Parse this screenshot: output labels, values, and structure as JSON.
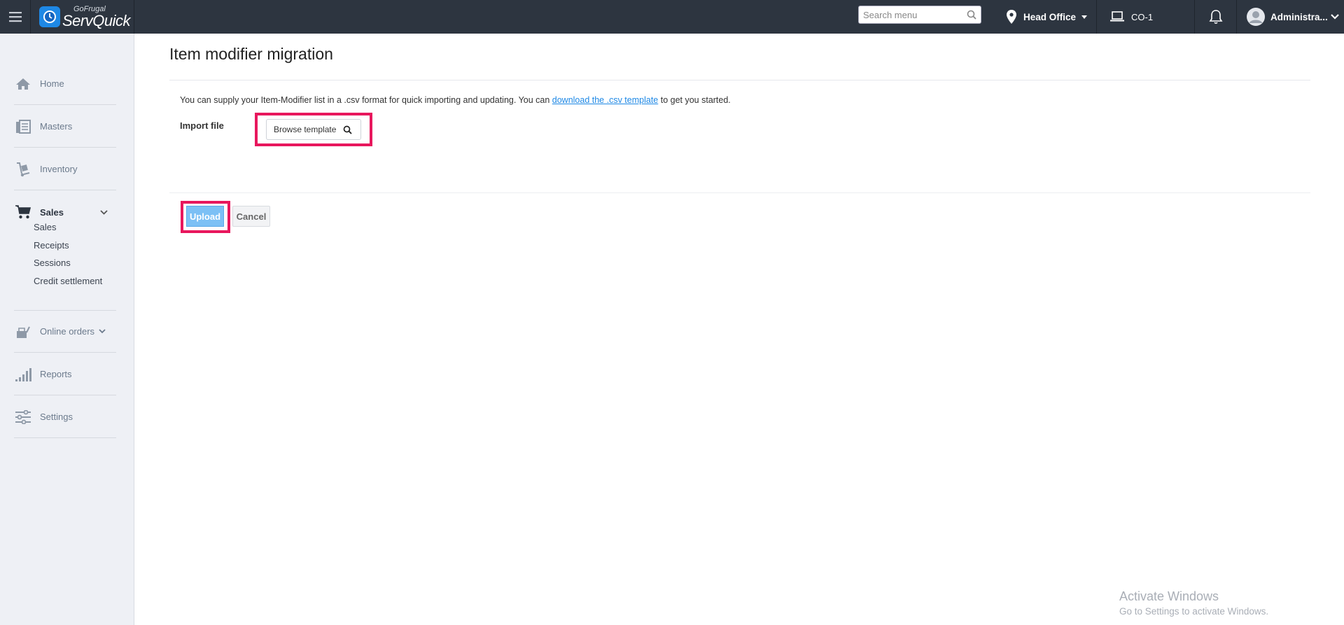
{
  "header": {
    "logo_small": "GoFrugal",
    "logo_big": "ServQuick",
    "search_placeholder": "Search menu",
    "location": "Head Office",
    "counter": "CO-1",
    "user": "Administra..."
  },
  "sidebar": {
    "items": [
      {
        "label": "Home"
      },
      {
        "label": "Masters"
      },
      {
        "label": "Inventory"
      },
      {
        "label": "Sales"
      },
      {
        "label": "Online orders"
      },
      {
        "label": "Reports"
      },
      {
        "label": "Settings"
      }
    ],
    "sales_sub": [
      {
        "label": "Sales"
      },
      {
        "label": "Receipts"
      },
      {
        "label": "Sessions"
      },
      {
        "label": "Credit settlement"
      }
    ]
  },
  "main": {
    "title": "Item modifier migration",
    "desc_before": "You can supply your Item-Modifier list in a .csv format for quick importing and updating. You can ",
    "desc_link": "download the .csv template",
    "desc_after": " to get you started.",
    "import_label": "Import file",
    "browse_label": "Browse template",
    "upload_label": "Upload",
    "cancel_label": "Cancel"
  },
  "watermark": {
    "title": "Activate Windows",
    "subtitle": "Go to Settings to activate Windows."
  },
  "colors": {
    "topbar": "#2d3540",
    "sidebar": "#eef0f5",
    "highlight": "#e8175d",
    "upload": "#7cc0f5",
    "link": "#1e88e5"
  }
}
